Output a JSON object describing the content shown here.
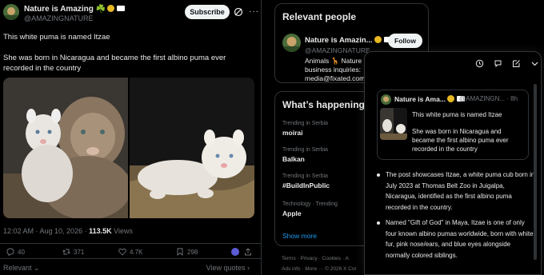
{
  "post": {
    "author_name": "Nature is Amazing ☘️",
    "author_handle": "@AMAZINGNATURE",
    "subscribe_label": "Subscribe",
    "text_line1": "This white puma is named Itzae",
    "text_line2": "She was born in Nicaragua and became the first albino puma ever recorded in the country",
    "time": "12:02 AM · Aug 10, 2026 · ",
    "views_count": "113.5K",
    "views_label": " Views",
    "replies": "40",
    "reposts": "371",
    "likes": "4.7K",
    "bookmarks": "298",
    "relevant_label": "Relevant ⌄",
    "view_quotes_label": "View quotes ›"
  },
  "relevant_people": {
    "title": "Relevant people",
    "name": "Nature is Amazin...",
    "handle": "@AMAZINGNATURE",
    "follow_label": "Follow",
    "bio": "Animals 🦒 Nature 🌿 business inquiries: media@fixated.com"
  },
  "whats_happening": {
    "title": "What’s happening",
    "trends": [
      {
        "category": "Trending in Serbia",
        "name": "moirai"
      },
      {
        "category": "Trending in Serbia",
        "name": "Balkan"
      },
      {
        "category": "Trending in Serbia",
        "name": "#BuildInPublic"
      },
      {
        "category": "Technology · Trending",
        "name": "Apple"
      }
    ],
    "show_more": "Show more"
  },
  "footer": {
    "line1": "Terms  ·  Privacy  ·  Cookies  ·  A",
    "line2": "Ads info  ·  More ···  © 2026 X Cor"
  },
  "grok_panel": {
    "quote_name": "Nature is Ama...",
    "quote_handle": "@AMAZINGN... · 8h",
    "quote_text1": "This white puma is named Itzae",
    "quote_text2": "She was born in Nicaragua and became the first albino puma ever recorded in the country",
    "bullets": [
      "The post showcases Itzae, a white puma cub born in July 2023 at Thomas Belt Zoo in Juigalpa, Nicaragua, identified as the first albino puma recorded in the country.",
      "Named \"Gift of God\" in Maya, Itzae is one of only four known albino pumas worldwide, born with white fur, pink nose/ears, and blue eyes alongside normally colored siblings."
    ]
  },
  "icons": [
    "grok-icon",
    "more-icon",
    "reply-icon",
    "repost-icon",
    "like-icon",
    "bookmark-icon",
    "share-icon",
    "history-icon",
    "new-chat-icon",
    "edit-icon",
    "chevron-down-icon"
  ],
  "colors": {
    "accent": "#1d9bf0",
    "verified": "#e8b923",
    "muted": "#71767b",
    "background": "#000000"
  }
}
